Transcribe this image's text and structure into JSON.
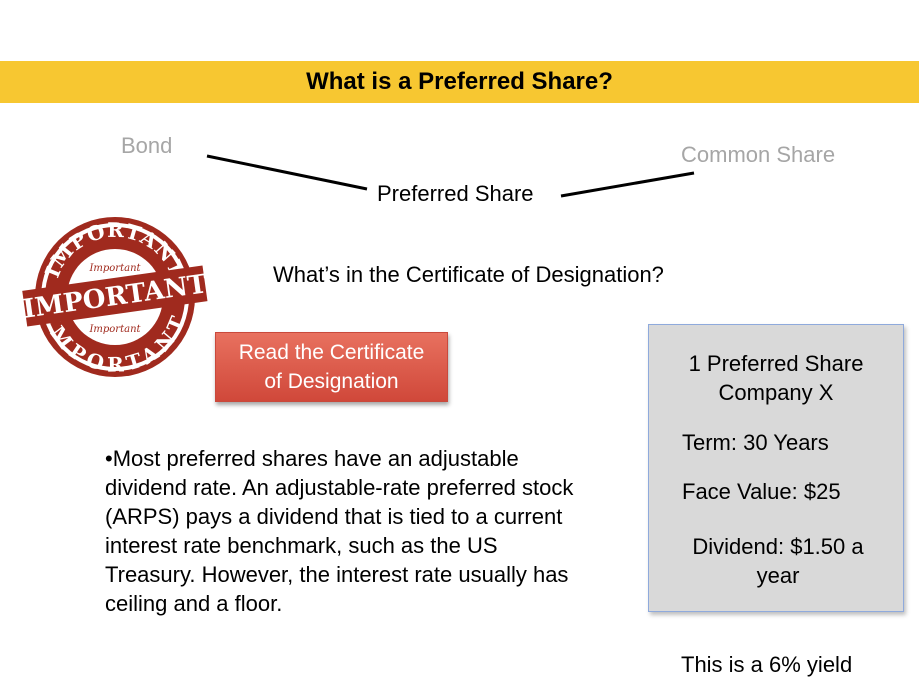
{
  "title": "What is a Preferred Share?",
  "spectrum": {
    "left": "Bond",
    "center": "Preferred Share",
    "right": "Common Share"
  },
  "stamp": {
    "top_text": "IMPORTANT",
    "small_top": "Important",
    "main": "IMPORTANT",
    "small_bottom": "Important",
    "bottom_text": "IMPORTANT"
  },
  "question": "What’s in the Certificate of Designation?",
  "button": {
    "line1": "Read the Certificate",
    "line2": "of Designation"
  },
  "body_text": "•Most preferred shares have an adjustable dividend rate. An adjustable-rate preferred stock (ARPS) pays a dividend that is tied to a current interest rate benchmark, such as the US Treasury. However, the interest rate usually has ceiling and a floor.",
  "card": {
    "title_line1": "1 Preferred Share",
    "title_line2": "Company X",
    "term": "Term: 30 Years",
    "face_value": "Face Value: $25",
    "dividend_line1": "Dividend: $1.50 a",
    "dividend_line2": "year"
  },
  "yield_note": "This is a 6% yield",
  "colors": {
    "title_bar": "#f7c731",
    "stamp": "#a02a1e",
    "button": "#dc5a4a",
    "card": "#d9d9d9"
  }
}
